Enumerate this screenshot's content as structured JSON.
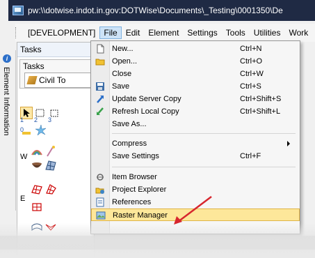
{
  "window": {
    "title": "pw:\\\\dotwise.indot.in.gov:DOTWise\\Documents\\_Testing\\0001350\\De"
  },
  "menubar": {
    "items": [
      {
        "label": "[DEVELOPMENT]"
      },
      {
        "label": "File"
      },
      {
        "label": "Edit"
      },
      {
        "label": "Element"
      },
      {
        "label": "Settings"
      },
      {
        "label": "Tools"
      },
      {
        "label": "Utilities"
      },
      {
        "label": "Work"
      }
    ]
  },
  "side_tab": {
    "label": "Element Information"
  },
  "tasks_panel": {
    "title": "Tasks",
    "inner_title": "Tasks",
    "tab_label": "Civil To",
    "row_letters": [
      "W",
      "E"
    ],
    "tool_labels": [
      "1",
      "2",
      "3",
      "0"
    ]
  },
  "file_menu": {
    "items": [
      {
        "label": "New...",
        "shortcut": "Ctrl+N",
        "icon": "new-file-icon"
      },
      {
        "label": "Open...",
        "shortcut": "Ctrl+O",
        "icon": "open-folder-icon"
      },
      {
        "label": "Close",
        "shortcut": "Ctrl+W",
        "icon": ""
      },
      {
        "label": "Save",
        "shortcut": "Ctrl+S",
        "icon": "save-icon"
      },
      {
        "label": "Update Server Copy",
        "shortcut": "Ctrl+Shift+S",
        "icon": "upload-arrow-icon"
      },
      {
        "label": "Refresh Local Copy",
        "shortcut": "Ctrl+Shift+L",
        "icon": "download-arrow-icon"
      },
      {
        "label": "Save As...",
        "shortcut": "",
        "icon": ""
      },
      {
        "label": "Compress",
        "shortcut": "",
        "icon": "",
        "submenu": true
      },
      {
        "label": "Save Settings",
        "shortcut": "Ctrl+F",
        "icon": ""
      },
      {
        "label": "Item Browser",
        "shortcut": "",
        "icon": "item-browser-icon"
      },
      {
        "label": "Project Explorer",
        "shortcut": "",
        "icon": "project-explorer-icon"
      },
      {
        "label": "References",
        "shortcut": "",
        "icon": "references-icon"
      },
      {
        "label": "Raster Manager",
        "shortcut": "",
        "icon": "raster-manager-icon",
        "highlighted": true
      }
    ]
  },
  "colors": {
    "highlight": "#fde79a",
    "annotation_arrow": "#d7262e",
    "titlebar": "#1f2a44"
  }
}
